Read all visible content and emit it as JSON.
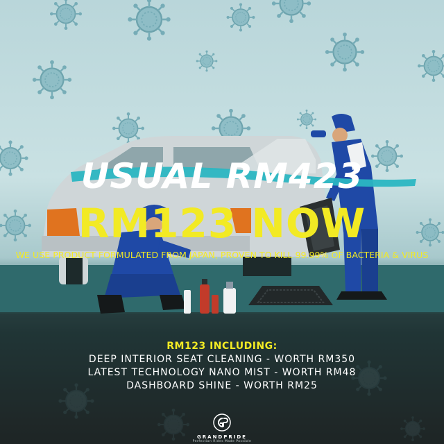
{
  "poster": {
    "headline_old": "USUAL RM423",
    "headline_new": "RM123 NOW",
    "tagline": "WE USE PRODUCT FORMULATED FROM JAPAN, PROVEN TO KILL 99.99% OF BACTERIA & VIRUS"
  },
  "includes": {
    "title": "RM123 INCLUDING:",
    "items": [
      "DEEP INTERIOR SEAT CLEANING - WORTH RM350",
      "LATEST TECHNOLOGY NANO MIST - WORTH RM48",
      "DASHBOARD SHINE - WORTH RM25"
    ]
  },
  "brand": {
    "name": "GRANDPRIDE",
    "tagline": "Perfection Rides Made Possible",
    "logo_icon": "gp-logo-icon"
  },
  "colors": {
    "accent_yellow": "#f2ea24",
    "strike_teal": "#2bb6c2",
    "virus": "#7fb3bd",
    "uniform_blue": "#1f49a6"
  }
}
